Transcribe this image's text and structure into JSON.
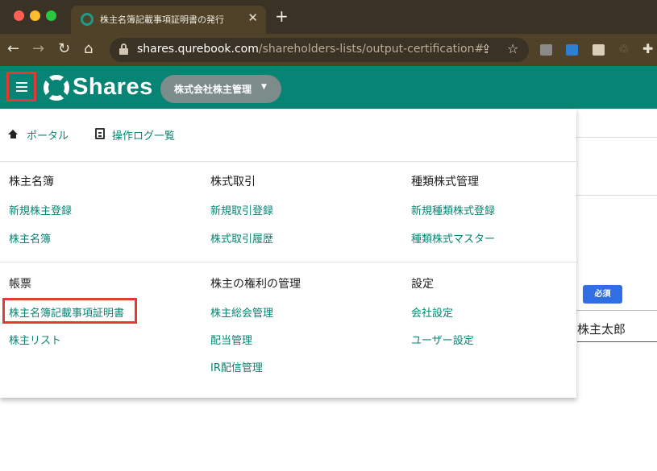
{
  "browser": {
    "tab_title": "株主名簿記載事項証明書の発行",
    "tab_close": "✕",
    "new_tab": "+",
    "url_host": "shares.qurebook.com",
    "url_path": "/shareholders-lists/output-certification#",
    "nav": {
      "back": "←",
      "forward": "→",
      "reload": "↻",
      "home": "⌂"
    },
    "share_glyph": "⇪",
    "star_glyph": "☆",
    "recycle_glyph": "♲",
    "puzzle_glyph": "✚"
  },
  "header": {
    "logo": "Shares",
    "company": "株式会社株主管理",
    "caret": "▼",
    "accent": "#078473"
  },
  "menu": {
    "top_links": [
      {
        "label": "ポータル",
        "icon": "home-icon"
      },
      {
        "label": "操作ログ一覧",
        "icon": "log-icon"
      }
    ],
    "sections": [
      [
        {
          "heading": "株主名簿",
          "items": [
            "新規株主登録",
            "株主名簿"
          ]
        },
        {
          "heading": "株式取引",
          "items": [
            "新規取引登録",
            "株式取引履歴"
          ]
        },
        {
          "heading": "種類株式管理",
          "items": [
            "新規種類株式登録",
            "種類株式マスター"
          ]
        }
      ],
      [
        {
          "heading": "帳票",
          "items": [
            "株主名簿記載事項証明書",
            "株主リスト"
          ]
        },
        {
          "heading": "株主の権利の管理",
          "items": [
            "株主総会管理",
            "配当管理",
            "IR配信管理"
          ]
        },
        {
          "heading": "設定",
          "items": [
            "会社設定",
            "ユーザー設定"
          ]
        }
      ]
    ]
  },
  "background": {
    "required_badge": "必須",
    "name_value": "株主太郎"
  }
}
